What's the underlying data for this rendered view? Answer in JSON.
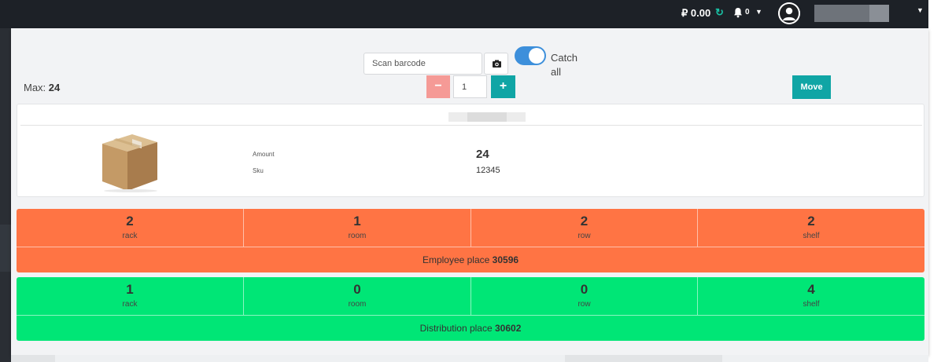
{
  "header": {
    "balance": "₽ 0.00",
    "refresh_icon": "↻",
    "notification_count": "0",
    "dropdown_caret": "▼",
    "user_menu_caret": "▼"
  },
  "toolbar": {
    "scan_placeholder": "Scan barcode",
    "catch_all_label_line1": "Catch",
    "catch_all_label_line2": "all",
    "catch_all_enabled": true,
    "max_label": "Max:",
    "max_value": "24",
    "decrement_label": "−",
    "quantity": "1",
    "increment_label": "+",
    "move_label": "Move"
  },
  "product": {
    "amount_label": "Amount",
    "amount_value": "24",
    "sku_label": "Sku",
    "sku_value": "12345"
  },
  "employee_place": {
    "cells": [
      {
        "value": "2",
        "label": "rack"
      },
      {
        "value": "1",
        "label": "room"
      },
      {
        "value": "2",
        "label": "row"
      },
      {
        "value": "2",
        "label": "shelf"
      }
    ],
    "footer_label": "Employee place",
    "footer_id": "30596"
  },
  "distribution_place": {
    "cells": [
      {
        "value": "1",
        "label": "rack"
      },
      {
        "value": "0",
        "label": "room"
      },
      {
        "value": "0",
        "label": "row"
      },
      {
        "value": "4",
        "label": "shelf"
      }
    ],
    "footer_label": "Distribution place",
    "footer_id": "30602"
  },
  "icons": {
    "refresh": "refresh-icon",
    "bell": "bell-icon",
    "camera": "camera-icon",
    "avatar": "user-avatar-icon",
    "product": "cardboard-box-image"
  },
  "colors": {
    "accent_teal": "#10a5a5",
    "toggle_blue": "#3d8fdb",
    "employee_orange": "#ff7444",
    "distribution_green": "#00e676",
    "decrement_pink": "#f59a96"
  }
}
